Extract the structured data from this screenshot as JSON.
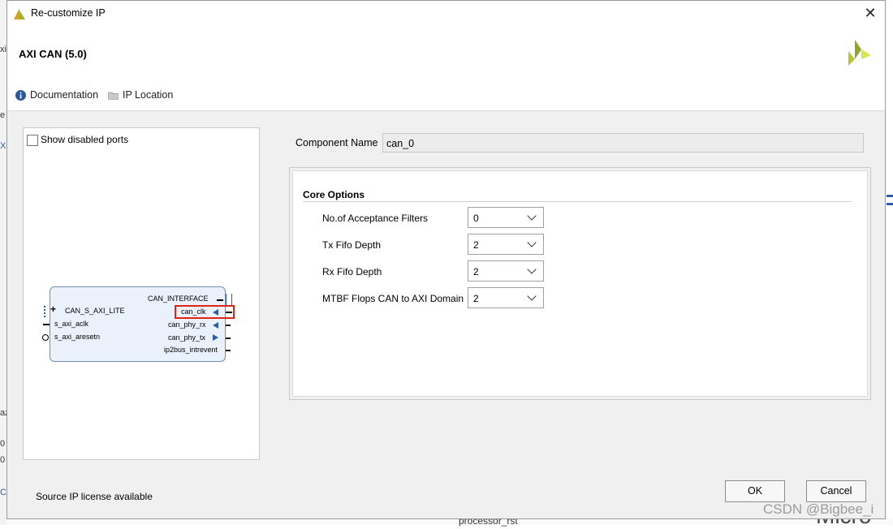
{
  "window": {
    "title": "Re-customize IP",
    "close_symbol": "✕"
  },
  "header": {
    "ip_name": "AXI CAN (5.0)",
    "documentation_label": "Documentation",
    "ip_location_label": "IP Location",
    "logo_icon": "xilinx-logo-icon"
  },
  "left_panel": {
    "show_disabled_ports_label": "Show disabled ports",
    "show_disabled_ports_checked": false,
    "block": {
      "left_ports": [
        "CAN_S_AXI_LITE",
        "s_axi_aclk",
        "s_axi_aresetn"
      ],
      "right_ports": [
        "CAN_INTERFACE",
        "can_clk",
        "can_phy_rx",
        "can_phy_tx",
        "ip2bus_intrevent"
      ],
      "plus_symbol": "+",
      "highlighted_port": "can_clk"
    }
  },
  "component": {
    "label": "Component Name",
    "value": "can_0"
  },
  "core_options": {
    "title": "Core Options",
    "fields": [
      {
        "label": "No.of Acceptance Filters",
        "value": "0"
      },
      {
        "label": "Tx Fifo Depth",
        "value": "2"
      },
      {
        "label": "Rx Fifo Depth",
        "value": "2"
      },
      {
        "label": "MTBF Flops CAN to AXI Domain",
        "value": "2"
      }
    ]
  },
  "footer": {
    "license_text": "Source IP license available",
    "ok_label": "OK",
    "cancel_label": "Cancel"
  },
  "background": {
    "bottom_text": "processor_rst",
    "right_text": "Micro",
    "left_fragments": [
      "xi",
      "e",
      "X",
      "az",
      "0",
      "0",
      "C"
    ]
  },
  "watermark": "CSDN @Bigbee_i",
  "colors": {
    "highlight": "#e1231a",
    "block_fill": "#eaf1fa",
    "logo": "#b5c62f"
  }
}
